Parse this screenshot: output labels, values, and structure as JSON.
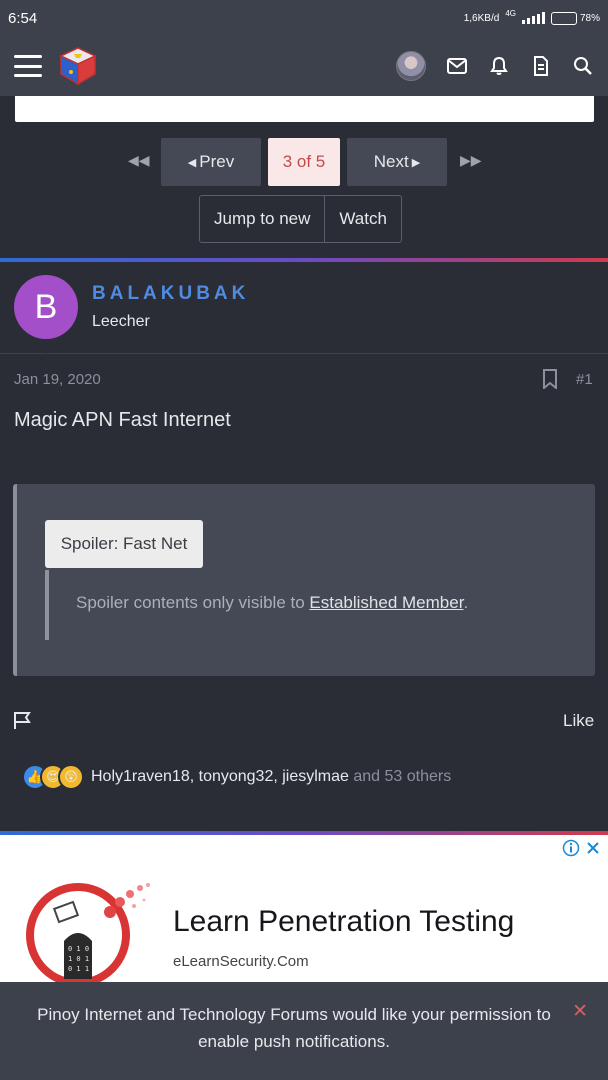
{
  "status_bar": {
    "time": "6:54",
    "network_speed": "1,6KB/d",
    "network_type": "4G",
    "battery": "78%",
    "battery_level": 0.78
  },
  "app_bar": {
    "icons": [
      "menu-icon",
      "logo-cube",
      "avatar",
      "mail-icon",
      "bell-icon",
      "document-icon",
      "search-icon"
    ]
  },
  "pager": {
    "prev_label": "Prev",
    "current_label": "3 of 5",
    "next_label": "Next"
  },
  "thread_actions": {
    "jump_label": "Jump to new",
    "watch_label": "Watch"
  },
  "post": {
    "author": {
      "initial": "B",
      "name": "BALAKUBAK",
      "title": "Leecher",
      "avatar_color": "#a24fc9"
    },
    "date": "Jan 19, 2020",
    "number": "#1",
    "title": "Magic APN Fast Internet",
    "spoiler": {
      "button_label": "Spoiler: Fast Net",
      "text_before": "Spoiler contents only visible to ",
      "link_text": "Established Member",
      "text_after": "."
    },
    "like_label": "Like",
    "reactions": {
      "users": "Holy1raven18, tonyong32, jiesylmae",
      "others": " and 53 others"
    }
  },
  "ad": {
    "title": "Learn Penetration Testing",
    "domain": "eLearnSecurity.Com"
  },
  "notification": {
    "message": "Pinoy Internet and Technology Forums would like your permission to enable push notifications."
  },
  "colors": {
    "background": "#2a2d35",
    "bar": "#3d414b",
    "accent_blue": "#4f8be0",
    "current_page_bg": "#fae8e8",
    "current_page_text": "#c24a4a"
  }
}
